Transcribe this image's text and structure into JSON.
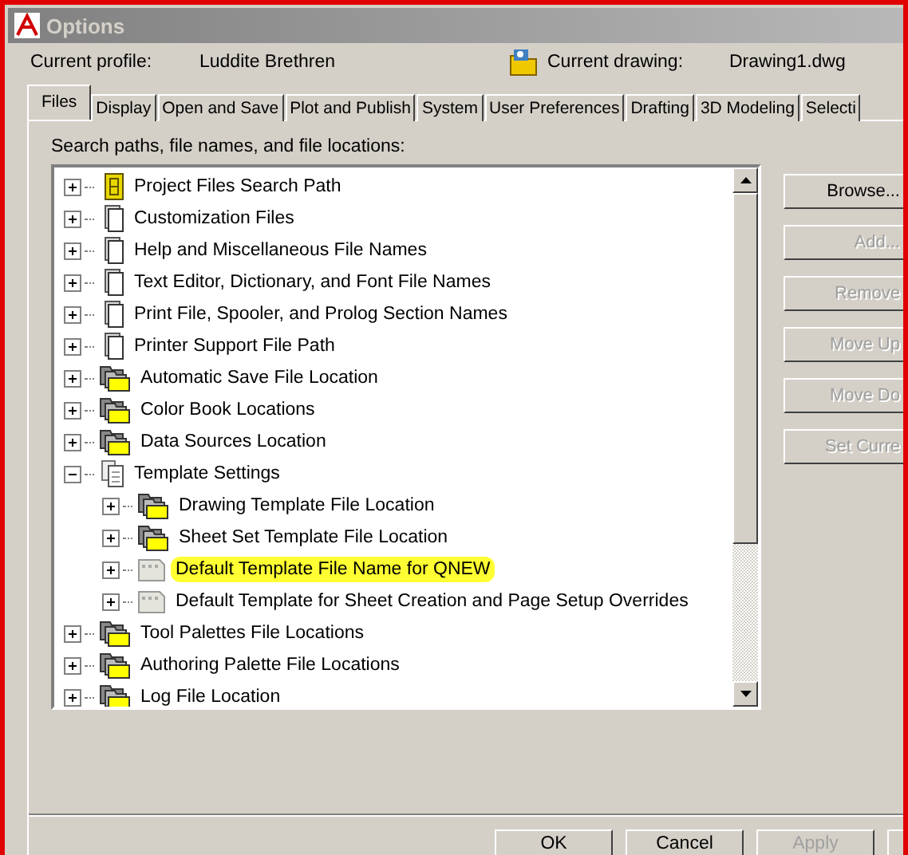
{
  "window": {
    "title": "Options"
  },
  "profile": {
    "label": "Current profile:",
    "value": "Luddite Brethren"
  },
  "drawing": {
    "label": "Current drawing:",
    "value": "Drawing1.dwg"
  },
  "tabs": [
    {
      "label": "Files",
      "selected": true
    },
    {
      "label": "Display",
      "selected": false
    },
    {
      "label": "Open and Save",
      "selected": false
    },
    {
      "label": "Plot and Publish",
      "selected": false
    },
    {
      "label": "System",
      "selected": false
    },
    {
      "label": "User Preferences",
      "selected": false
    },
    {
      "label": "Drafting",
      "selected": false
    },
    {
      "label": "3D Modeling",
      "selected": false
    },
    {
      "label": "Selecti",
      "selected": false
    }
  ],
  "tree_label": "Search paths, file names, and file locations:",
  "tree": [
    {
      "label": "Project Files Search Path",
      "kind": "path",
      "expanded": false,
      "highlighted": false
    },
    {
      "label": "Customization Files",
      "kind": "file",
      "expanded": false,
      "highlighted": false
    },
    {
      "label": "Help and Miscellaneous File Names",
      "kind": "file",
      "expanded": false,
      "highlighted": false
    },
    {
      "label": "Text Editor, Dictionary, and Font File Names",
      "kind": "file",
      "expanded": false,
      "highlighted": false
    },
    {
      "label": "Print File, Spooler, and Prolog Section Names",
      "kind": "file",
      "expanded": false,
      "highlighted": false
    },
    {
      "label": "Printer Support File Path",
      "kind": "file",
      "expanded": false,
      "highlighted": false
    },
    {
      "label": "Automatic Save File Location",
      "kind": "folders",
      "expanded": false,
      "highlighted": false
    },
    {
      "label": "Color Book Locations",
      "kind": "folders",
      "expanded": false,
      "highlighted": false
    },
    {
      "label": "Data Sources Location",
      "kind": "folders",
      "expanded": false,
      "highlighted": false
    },
    {
      "label": "Template Settings",
      "kind": "settings",
      "expanded": true,
      "highlighted": false,
      "children": [
        {
          "label": "Drawing Template File Location",
          "kind": "folders",
          "expanded": false,
          "highlighted": false
        },
        {
          "label": "Sheet Set Template File Location",
          "kind": "folders",
          "expanded": false,
          "highlighted": false
        },
        {
          "label": "Default Template File Name for QNEW",
          "kind": "template",
          "expanded": false,
          "highlighted": true
        },
        {
          "label": "Default Template for Sheet Creation and Page Setup Overrides",
          "kind": "template",
          "expanded": false,
          "highlighted": false
        }
      ]
    },
    {
      "label": "Tool Palettes File Locations",
      "kind": "folders",
      "expanded": false,
      "highlighted": false
    },
    {
      "label": "Authoring Palette File Locations",
      "kind": "folders",
      "expanded": false,
      "highlighted": false
    },
    {
      "label": "Log File Location",
      "kind": "folders",
      "expanded": false,
      "highlighted": false
    }
  ],
  "side_buttons": [
    {
      "label": "Browse...",
      "disabled": false
    },
    {
      "label": "Add...",
      "disabled": true
    },
    {
      "label": "Remove",
      "disabled": true
    },
    {
      "label": "Move Up",
      "disabled": true
    },
    {
      "label": "Move Do",
      "disabled": true
    },
    {
      "label": "Set Curre",
      "disabled": true
    }
  ],
  "footer_buttons": [
    {
      "label": "OK",
      "disabled": false
    },
    {
      "label": "Cancel",
      "disabled": false
    },
    {
      "label": "Apply",
      "disabled": true
    }
  ]
}
